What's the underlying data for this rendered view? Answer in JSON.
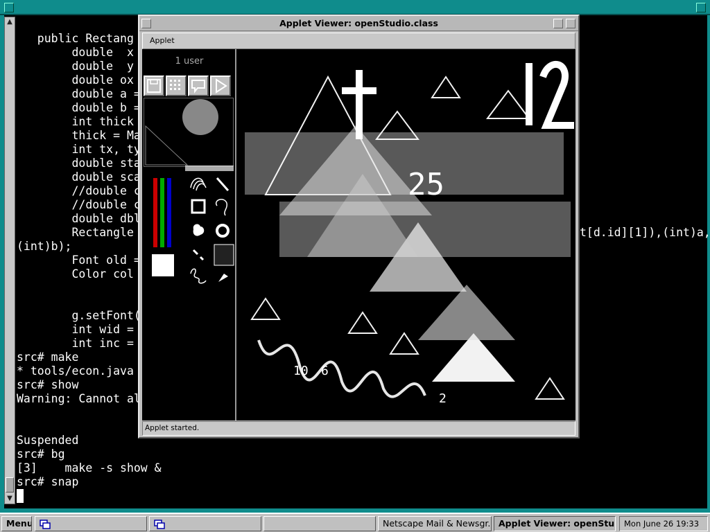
{
  "terminal": {
    "lines": [
      "   public Rectang",
      "        double  x",
      "        double  y",
      "        double ox",
      "        double a =",
      "        double b =",
      "        int thick",
      "        thick = Ma",
      "        int tx, ty",
      "        double sta",
      "        double sca",
      "        //double c",
      "        //double c",
      "        double dbl",
      "        Rectangle",
      "(int)b);",
      "        Font old =",
      "        Color col",
      "",
      "",
      "        g.setFont(",
      "        int wid =",
      "        int inc =",
      "src# make",
      "* tools/econ.java",
      "src# show",
      "Warning: Cannot al",
      "",
      "",
      "Suspended",
      "src# bg",
      "[3]    make -s show &",
      "src# snap"
    ],
    "overflow_text": "t[d.id][1]),(int)a,"
  },
  "applet_window": {
    "title": "Applet Viewer: openStudio.class",
    "menu_label": "Applet",
    "status": "Applet started.",
    "user_count_label": "1 user"
  },
  "taskbar": {
    "menu_label": "Menu",
    "items": [
      {
        "label": ""
      },
      {
        "label": ""
      },
      {
        "label": ""
      },
      {
        "label": "Netscape Mail & Newsgr..."
      },
      {
        "label": "Applet Viewer: openStu..."
      }
    ],
    "clock": "Mon June 26 19:33"
  },
  "colors": {
    "titlebar": "#0f8c8c",
    "chrome": "#c0c0c0",
    "terminal_bg": "#000000",
    "terminal_fg": "#ffffff"
  }
}
